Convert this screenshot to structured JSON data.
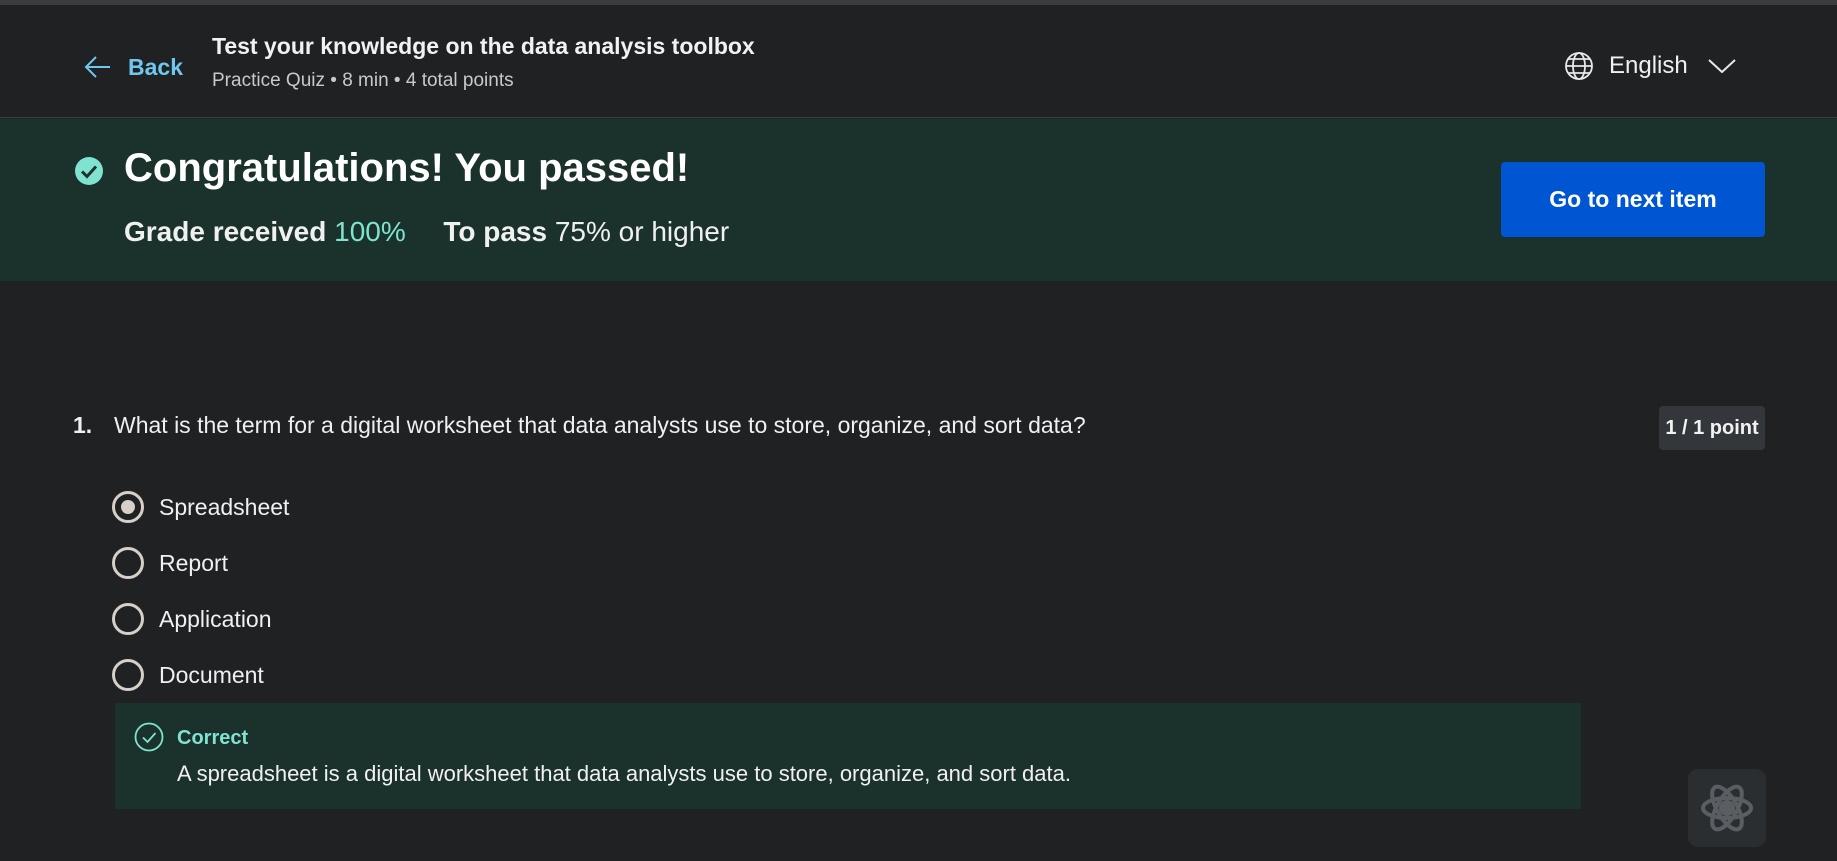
{
  "header": {
    "back_label": "Back",
    "title": "Test your knowledge on the data analysis toolbox",
    "meta": "Practice Quiz • 8 min • 4 total points",
    "language": "English"
  },
  "banner": {
    "headline": "Congratulations! You passed!",
    "grade_label": "Grade received",
    "grade_value": "100%",
    "pass_label": "To pass",
    "pass_value": "75% or higher",
    "next_button": "Go to next item"
  },
  "question": {
    "number": "1.",
    "text": "What is the term for a digital worksheet that data analysts use to store, organize, and sort data?",
    "points": "1 / 1 point",
    "options": [
      {
        "label": "Spreadsheet",
        "selected": true
      },
      {
        "label": "Report",
        "selected": false
      },
      {
        "label": "Application",
        "selected": false
      },
      {
        "label": "Document",
        "selected": false
      }
    ],
    "feedback": {
      "status": "Correct",
      "explanation": "A spreadsheet is a digital worksheet that data analysts use to store, organize, and sort data."
    }
  },
  "colors": {
    "accent_link": "#6fc7ef",
    "success": "#7fe3d2",
    "primary_button": "#0056d2",
    "banner_bg": "#1b322c"
  },
  "icons": {
    "back": "arrow-left-icon",
    "language": "globe-icon",
    "dropdown": "chevron-down-icon",
    "passed": "check-circle-filled-icon",
    "correct": "check-circle-outline-icon",
    "coach": "coach-assistant-icon"
  }
}
